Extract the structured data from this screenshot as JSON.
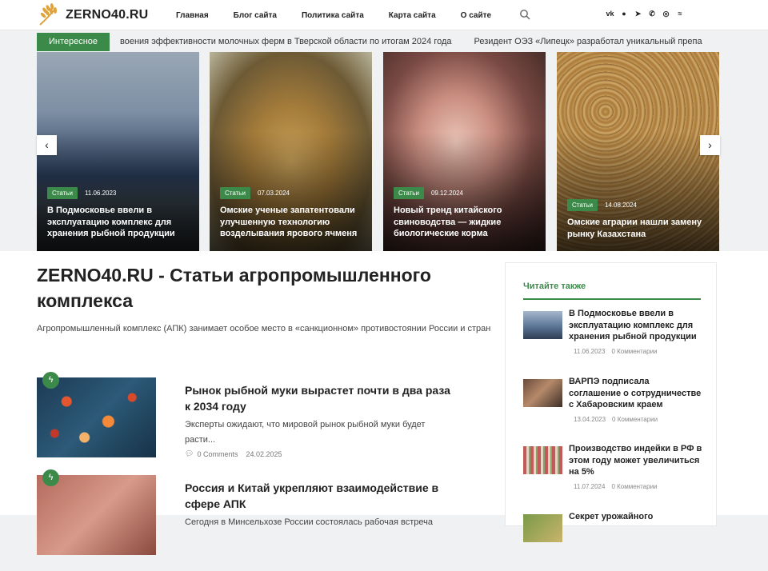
{
  "site": {
    "logo_text": "ZERNO40.RU",
    "nav": [
      "Главная",
      "Блог сайта",
      "Политика сайта",
      "Карта сайта",
      "О сайте"
    ],
    "socials": [
      "vk-icon",
      "ok-icon",
      "telegram-icon",
      "phone-icon",
      "whatsapp-icon",
      "rss-icon"
    ]
  },
  "ticker": {
    "label": "Интересное",
    "items": [
      "воения эффективности молочных ферм в Тверской области по итогам 2024 года",
      "Резидент ОЭЗ «Липецк» разработал уникальный препа"
    ]
  },
  "slides": [
    {
      "tag": "Статьи",
      "date": "11.06.2023",
      "title": "В Подмосковье ввели в эксплуатацию комплекс для хранения рыбной продукции"
    },
    {
      "tag": "Статьи",
      "date": "07.03.2024",
      "title": "Омские ученые запатентовали улучшенную технологию возделывания ярового ячменя"
    },
    {
      "tag": "Статьи",
      "date": "09.12.2024",
      "title": "Новый тренд китайского свиноводства — жидкие биологические корма"
    },
    {
      "tag": "Статьи",
      "date": "14.08.2024",
      "title": "Омские аграрии нашли замену рынку Казахстана"
    }
  ],
  "slider_nav": {
    "prev": "‹",
    "next": "›"
  },
  "main": {
    "title": "ZERNO40.RU - Статьи агропромышленного комплекса",
    "lead": "Агропромышленный комплекс (АПК) занимает особое место в «санкционном» противостоянии России и стран",
    "posts": [
      {
        "title": "Рынок рыбной муки вырастет почти в два раза к 2034 году",
        "excerpt": "  Эксперты ожидают, что мировой рынок рыбной муки будет расти...",
        "comments": "0 Comments",
        "date": "24.02.2025"
      },
      {
        "title": "Россия и Китай укрепляют взаимодействие в сфере АПК",
        "excerpt": "Сегодня в Минсельхозе России состоялась рабочая встреча",
        "comments": "",
        "date": ""
      }
    ]
  },
  "sidebar": {
    "title": "Читайте также",
    "items": [
      {
        "title": "В Подмосковье ввели в эксплуатацию комплекс для хранения рыбной продукции",
        "date": "11.06.2023",
        "comments": "0 Комментарии"
      },
      {
        "title": "ВАРПЭ подписала соглашение о сотрудничестве с Хабаровским краем",
        "date": "13.04.2023",
        "comments": "0 Комментарии"
      },
      {
        "title": "Производство индейки в РФ в этом году может увеличиться на 5%",
        "date": "11.07.2024",
        "comments": "0 Комментарии"
      },
      {
        "title": "Секрет урожайного",
        "date": "",
        "comments": ""
      }
    ]
  },
  "colors": {
    "accent": "#3c8a4a",
    "logo_gold": "#e0a23a"
  }
}
